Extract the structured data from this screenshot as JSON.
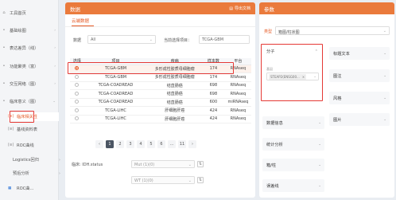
{
  "sidebar": {
    "items": [
      {
        "label": "工具首页"
      },
      {
        "label": "基础绘图"
      },
      {
        "label": "表达差异（线）"
      },
      {
        "label": "功能聚类（富）"
      },
      {
        "label": "交互网络（图）"
      },
      {
        "label": "临床意义（图）"
      }
    ],
    "sub_items": [
      {
        "label": "临床相关性"
      },
      {
        "label": "基线资料表"
      },
      {
        "label": "ROC曲线"
      },
      {
        "label": "Logistics回归"
      },
      {
        "label": "预后分析"
      },
      {
        "label": "ROC曲..."
      }
    ]
  },
  "data_panel": {
    "title": "数据",
    "export_label": "导出文档",
    "tab": "云端数据",
    "filters": {
      "dataset_label": "数据",
      "dataset_value": "All",
      "project_label": "当前选择项目：",
      "project_value": "TCGA-GBM"
    },
    "table": {
      "headers": [
        "选择",
        "项目",
        "疾病",
        "样本数",
        "平台"
      ],
      "rows": [
        {
          "project": "TCGA-GBM",
          "disease": "多形成性胶质母细胞瘤",
          "samples": "174",
          "platform": "RNAseq",
          "selected": true
        },
        {
          "project": "TCGA-GBM",
          "disease": "多形成性胶质母细胞瘤",
          "samples": "174",
          "platform": "RNAseq",
          "selected": false
        },
        {
          "project": "TCGA-COADREAD",
          "disease": "结直肠癌",
          "samples": "698",
          "platform": "RNAseq",
          "selected": false
        },
        {
          "project": "TCGA-COADREAD",
          "disease": "结直肠癌",
          "samples": "698",
          "platform": "RNAseq",
          "selected": false
        },
        {
          "project": "TCGA-COADREAD",
          "disease": "结直肠癌",
          "samples": "600",
          "platform": "miRNAseq",
          "selected": false
        },
        {
          "project": "TCGA-LIHC",
          "disease": "肝细胞肝癌",
          "samples": "424",
          "platform": "RNAseq",
          "selected": false
        },
        {
          "project": "TCGA-LIHC",
          "disease": "肝细胞肝癌",
          "samples": "424",
          "platform": "RNAseq",
          "selected": false
        }
      ]
    },
    "pagination": {
      "prev": "‹",
      "pages": [
        "1",
        "2",
        "3",
        "4",
        "5",
        "6"
      ],
      "ellipsis": "...",
      "last": "11",
      "next": "›",
      "current": "1"
    },
    "clinical": {
      "label": "临床: IDH.status",
      "option1": "Mut (1)(0)",
      "option2": "WT (1)(0)"
    }
  },
  "param_panel": {
    "title": "参数",
    "type_label": "类型",
    "type_value": "箱图/柱状图",
    "gene_header": "分子",
    "gene_sublabel": "基因",
    "gene_tag": "STEAP2(ENSG00...",
    "cards": [
      {
        "label": "标题文本"
      },
      {
        "label": "图注"
      },
      {
        "label": "风格"
      },
      {
        "label": "图片"
      },
      {
        "label": "数据信息"
      },
      {
        "label": "统计分析"
      },
      {
        "label": "箱/柱"
      },
      {
        "label": "误差线"
      }
    ]
  },
  "colors": {
    "accent": "#ea7a3c",
    "highlight": "#e53935"
  }
}
